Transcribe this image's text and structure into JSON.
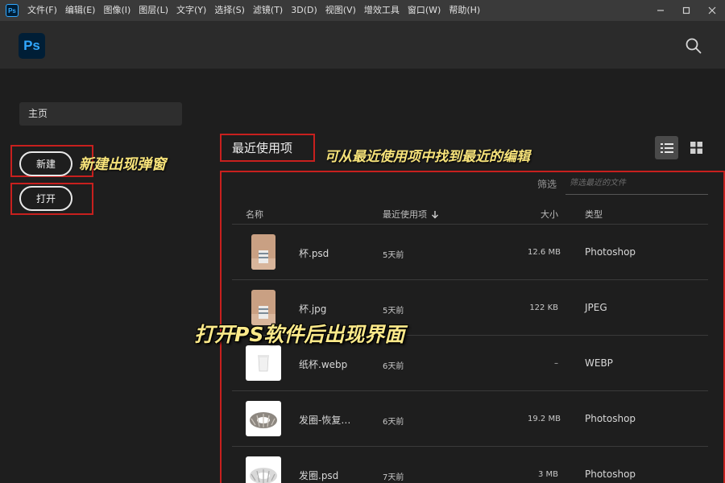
{
  "menubar": {
    "app_icon": "Ps",
    "items": [
      "文件(F)",
      "编辑(E)",
      "图像(I)",
      "图层(L)",
      "文字(Y)",
      "选择(S)",
      "滤镜(T)",
      "3D(D)",
      "视图(V)",
      "增效工具",
      "窗口(W)",
      "帮助(H)"
    ]
  },
  "header": {
    "logo": "Ps",
    "search_icon": "search-icon"
  },
  "sidebar": {
    "home_label": "主页",
    "new_label": "新建",
    "open_label": "打开"
  },
  "annotations": {
    "new_note": "新建出现弹窗",
    "recent_note": "可从最近使用项中找到最近的编辑",
    "main_note": "打开PS软件后出现界面"
  },
  "recent": {
    "title": "最近使用项",
    "filter_label": "筛选",
    "filter_placeholder": "筛选最近的文件",
    "columns": {
      "name": "名称",
      "recent": "最近使用项",
      "size": "大小",
      "type": "类型"
    },
    "files": [
      {
        "name": "杯.psd",
        "time": "5天前",
        "size": "12.6 MB",
        "type": "Photoshop",
        "thumb": "cup-psd"
      },
      {
        "name": "杯.jpg",
        "time": "5天前",
        "size": "122 KB",
        "type": "JPEG",
        "thumb": "cup-jpg"
      },
      {
        "name": "纸杯.webp",
        "time": "6天前",
        "size": "–",
        "type": "WEBP",
        "thumb": "paper-cup"
      },
      {
        "name": "发圈-恢复…",
        "time": "6天前",
        "size": "19.2 MB",
        "type": "Photoshop",
        "thumb": "scrunchie"
      },
      {
        "name": "发圈.psd",
        "time": "7天前",
        "size": "3 MB",
        "type": "Photoshop",
        "thumb": "scrunchie-white"
      }
    ]
  },
  "colors": {
    "accent": "#31a8ff",
    "highlight_box": "#c8201e",
    "annotation": "#f7e37a"
  }
}
